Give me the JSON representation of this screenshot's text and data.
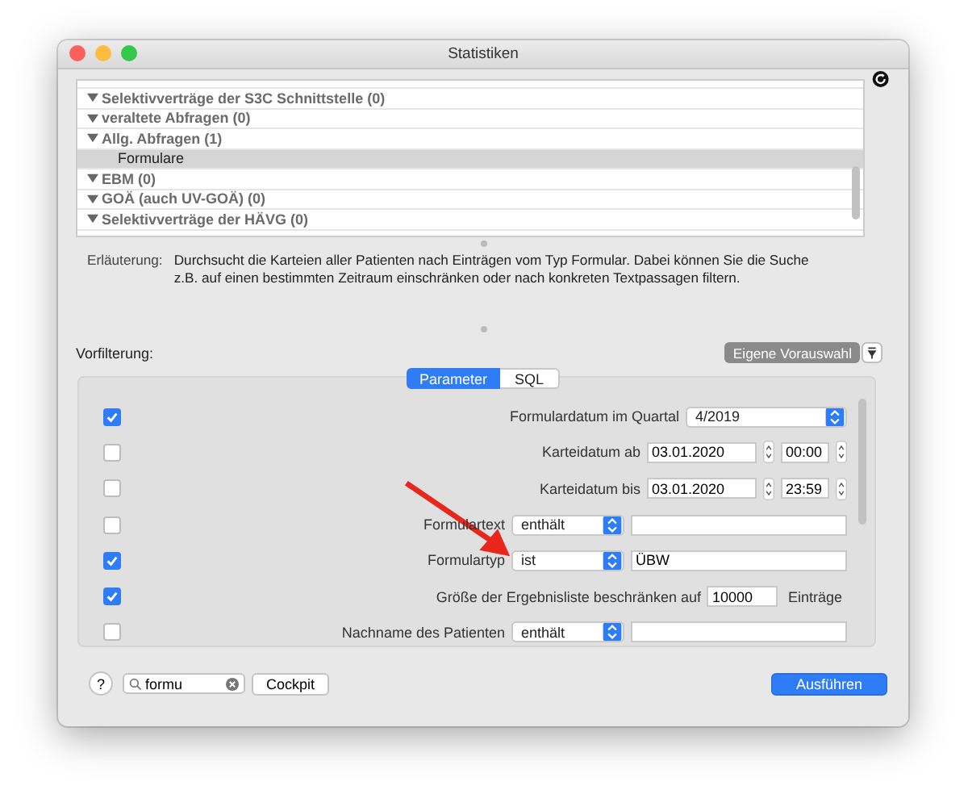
{
  "window": {
    "title": "Statistiken"
  },
  "tree": {
    "items": [
      {
        "label": "Selektivverträge der S3C Schnittstelle (0)",
        "expanded": true,
        "selected": false
      },
      {
        "label": "veraltete Abfragen (0)",
        "expanded": true,
        "selected": false
      },
      {
        "label": "Allg. Abfragen (1)",
        "expanded": true,
        "selected": false,
        "children": [
          {
            "label": "Formulare",
            "selected": true
          }
        ]
      },
      {
        "label": "EBM (0)",
        "expanded": true,
        "selected": false
      },
      {
        "label": "GOÄ (auch UV-GOÄ) (0)",
        "expanded": true,
        "selected": false
      },
      {
        "label": "Selektivverträge der HÄVG (0)",
        "expanded": true,
        "selected": false
      }
    ]
  },
  "explanation": {
    "label": "Erläuterung:",
    "text": "Durchsucht die Karteien aller Patienten nach Einträgen vom Typ Formular. Dabei können Sie die Suche z.B. auf einen bestimmten Zeitraum einschränken oder nach konkreten Textpassagen filtern."
  },
  "prefilter": {
    "label": "Vorfilterung:",
    "button": "Eigene Vorauswahl"
  },
  "tabs": [
    {
      "label": "Parameter",
      "selected": true
    },
    {
      "label": "SQL",
      "selected": false
    }
  ],
  "parameters": [
    {
      "kind": "popup",
      "checked": true,
      "label": "Formulardatum im Quartal",
      "value": "4/2019"
    },
    {
      "kind": "datetime",
      "checked": false,
      "label": "Karteidatum ab",
      "date": "03.01.2020",
      "time": "00:00"
    },
    {
      "kind": "datetime",
      "checked": false,
      "label": "Karteidatum bis",
      "date": "03.01.2020",
      "time": "23:59"
    },
    {
      "kind": "operator",
      "checked": false,
      "label": "Formulartext",
      "operator": "enthält"
    },
    {
      "kind": "operator",
      "checked": true,
      "label": "Formulartyp",
      "operator": "ist",
      "value": "ÜBW"
    },
    {
      "kind": "limit",
      "checked": true,
      "label": "Größe der Ergebnisliste beschränken auf",
      "value": "10000",
      "suffix": "Einträge"
    },
    {
      "kind": "operator",
      "checked": false,
      "label": "Nachname des Patienten",
      "operator": "enthält"
    }
  ],
  "footer": {
    "help": "?",
    "search": "formu",
    "cockpit": "Cockpit",
    "run": "Ausführen"
  }
}
